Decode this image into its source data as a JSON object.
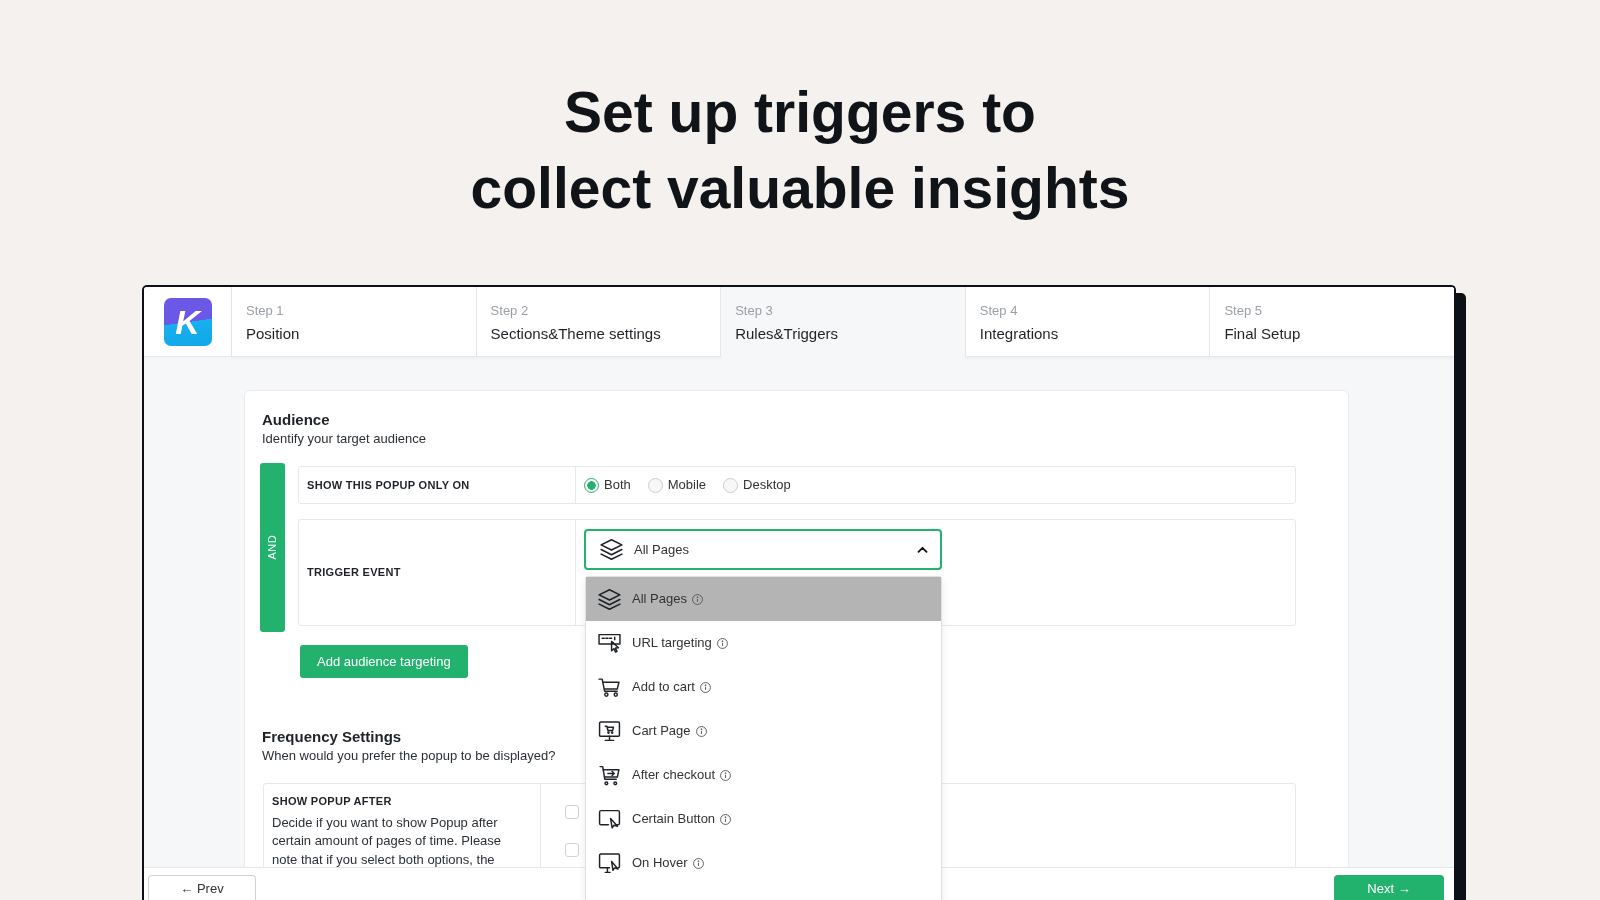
{
  "headline": "Set up triggers to\ncollect valuable insights",
  "app": {
    "logo": "K",
    "steps": [
      {
        "step": "Step 1",
        "title": "Position",
        "selected": false
      },
      {
        "step": "Step 2",
        "title": "Sections&Theme settings",
        "selected": false
      },
      {
        "step": "Step 3",
        "title": "Rules&Triggers",
        "selected": true
      },
      {
        "step": "Step 4",
        "title": "Integrations",
        "selected": false
      },
      {
        "step": "Step 5",
        "title": "Final Setup",
        "selected": false
      }
    ],
    "audience": {
      "title": "Audience",
      "subtitle": "Identify your target audience",
      "connector": "AND",
      "show_on": {
        "label": "SHOW THIS POPUP ONLY ON",
        "options": [
          {
            "label": "Both",
            "selected": true
          },
          {
            "label": "Mobile",
            "selected": false
          },
          {
            "label": "Desktop",
            "selected": false
          }
        ]
      },
      "trigger_event": {
        "label": "TRIGGER EVENT",
        "value": "All Pages",
        "expanded": true,
        "options": [
          {
            "label": "All Pages",
            "selected": true
          },
          {
            "label": "URL targeting",
            "selected": false
          },
          {
            "label": "Add to cart",
            "selected": false
          },
          {
            "label": "Cart Page",
            "selected": false
          },
          {
            "label": "After checkout",
            "selected": false
          },
          {
            "label": "Certain Button",
            "selected": false
          },
          {
            "label": "On Hover",
            "selected": false
          }
        ]
      },
      "add_button": "Add audience targeting"
    },
    "frequency": {
      "title": "Frequency Settings",
      "subtitle": "When would you prefer the popup to be displayed?",
      "show_after": {
        "label": "SHOW POPUP AFTER",
        "description": "Decide if you want to show Popup after certain amount of pages of time. Please note that if you select both options, the",
        "checkboxes": [
          {
            "checked": false
          },
          {
            "checked": false
          }
        ]
      }
    },
    "footer": {
      "prev": "← Prev",
      "next": "Next →"
    }
  }
}
